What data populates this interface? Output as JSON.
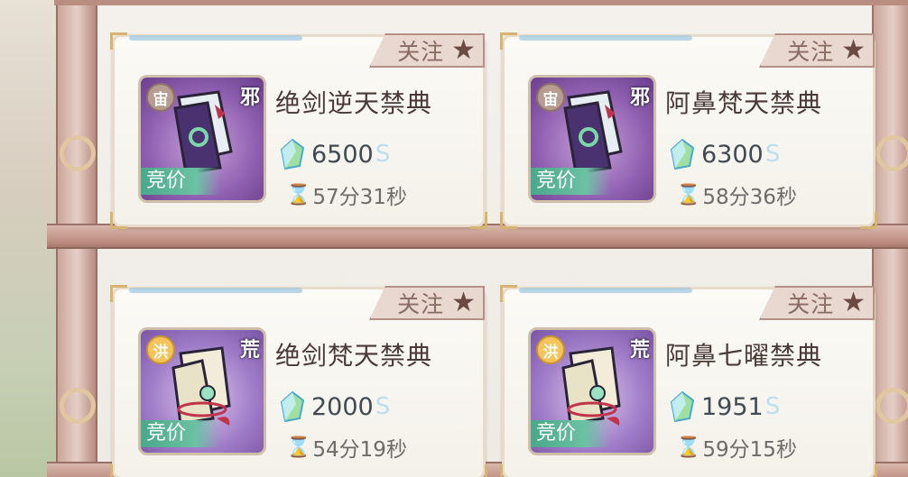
{
  "follow_label": "关注",
  "auction_label": "竞价",
  "icons": {
    "follow": "star-icon",
    "currency": "gem-icon",
    "timer": "hourglass-icon",
    "item": "book-icon"
  },
  "colors": {
    "auction_tag": "#4aa88a",
    "item_name": "#4a3a36",
    "follow_tag": "#e8d8cf"
  },
  "listings": [
    {
      "name": "绝剑逆天禁典",
      "rarity_mark": "宙",
      "type_tag": "邪",
      "price": "6500",
      "time_left": "57分31秒"
    },
    {
      "name": "阿鼻梵天禁典",
      "rarity_mark": "宙",
      "type_tag": "邪",
      "price": "6300",
      "time_left": "58分36秒"
    },
    {
      "name": "绝剑梵天禁典",
      "rarity_mark": "洪",
      "type_tag": "荒",
      "price": "2000",
      "time_left": "54分19秒"
    },
    {
      "name": "阿鼻七曜禁典",
      "rarity_mark": "洪",
      "type_tag": "荒",
      "price": "1951",
      "time_left": "59分15秒"
    }
  ]
}
